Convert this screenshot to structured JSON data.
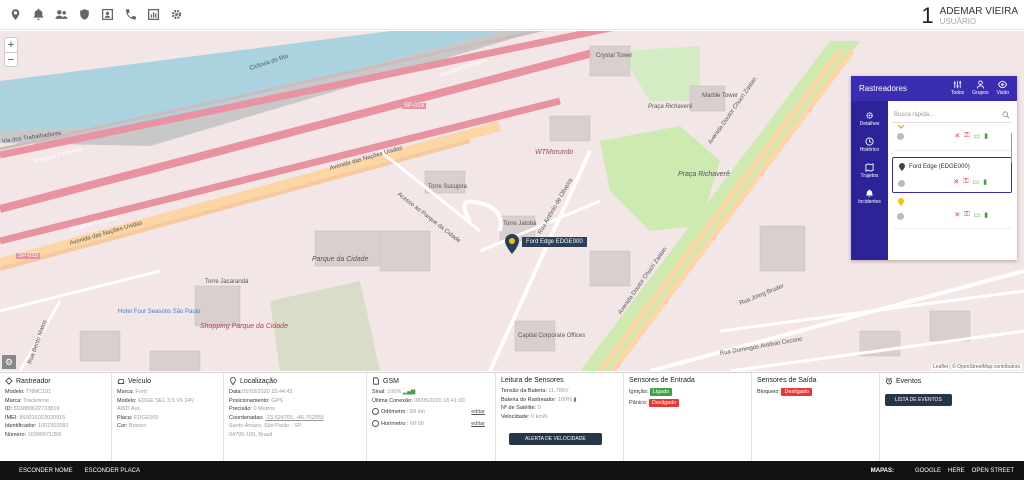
{
  "header": {
    "user_count": "1",
    "user_name": "ADEMAR VIEIRA",
    "user_role": "USUÁRIO"
  },
  "map": {
    "zoom_in": "+",
    "zoom_out": "−",
    "labels": {
      "marginal1": "Marginal Pinheiros",
      "marginal2": "Marginal Pinheiros",
      "marginal3": "Marginal Pinheiros",
      "nacoes1": "Avenida das Nações Unidas",
      "nacoes2": "Avenida das Nações Unidas",
      "sp015a": "SP-015",
      "sp015b": "SP-015",
      "ciclovia": "Ciclovia do Rio",
      "trabalhadores": "Via dos Trabalhadores",
      "crystal": "Crystal Tower",
      "marble": "Marble Tower",
      "wtmorumbi": "WTMorumbi",
      "pracaricha1": "Praça Richaverê",
      "pracaricha2": "Praça Richaverê",
      "sucupira": "Torre Sucupira",
      "jatoba": "Torre Jatobá",
      "capital": "Capital Corporate Offices",
      "parque": "Parque da Cidade",
      "shopping": "Shopping Parque da Cidade",
      "chucri1": "Avenida Doutor Chucri Zaidan",
      "chucri2": "Avenida Doutor Chucri Zaidan",
      "oliveira": "Rua Antônio de Oliveira",
      "acesso": "Acesso ao Parque da Cidade",
      "bruder": "Rua Joerg Bruder",
      "antonio_carlos": "Rua Domingos Antônio Cecone",
      "mattos": "Rua Bento Matos",
      "four_seasons": "Hotel Four Seasons São Paulo",
      "torre_jacaranda": "Torre Jacarandá"
    },
    "marker_label": "Ford Edge EDGE000",
    "attribution": "Leaflet | © OpenStreetMap contributors"
  },
  "trackers_panel": {
    "title": "Rastreadores",
    "views": [
      "Todos",
      "Grupos",
      "Visão"
    ],
    "side": [
      "Detalhes",
      "Histórico",
      "Trajetos",
      "Incidentes"
    ],
    "search_placeholder": "Busca rápida...",
    "items": [
      {
        "name": "",
        "pin_color": "#f39c12",
        "dot_color": "#bbb"
      },
      {
        "name": "Ford Edge (EDGE000)",
        "pin_color": "#444",
        "dot_color": "#bbb"
      },
      {
        "name": "",
        "pin_color": "#f1c40f",
        "dot_color": "#bbb"
      }
    ]
  },
  "info": {
    "rastreador": {
      "title": "Rastreador",
      "rows": [
        {
          "k": "Modelo:",
          "v": "TNMC101"
        },
        {
          "k": "Marca:",
          "v": "Trackmme"
        },
        {
          "k": "ID:",
          "v": "553889622733819"
        },
        {
          "k": "IMEI:",
          "v": "860016023020915"
        },
        {
          "k": "Identificador:",
          "v": "1602302091"
        },
        {
          "k": "Número:",
          "v": "16999971356"
        }
      ]
    },
    "veiculo": {
      "title": "Veículo",
      "rows": [
        {
          "k": "Marca:",
          "v": "Ford"
        },
        {
          "k": "Modelo:",
          "v": "EDGE SEL 3.5 V6 24V"
        },
        {
          "k": "",
          "v": "AWD Aut."
        },
        {
          "k": "Placa:",
          "v": "EDGE000"
        },
        {
          "k": "Cor:",
          "v": "Branco"
        }
      ]
    },
    "localizacao": {
      "title": "Localização",
      "rows": [
        {
          "k": "Data:",
          "v": "05/03/2020 15:44:43"
        },
        {
          "k": "Posicionamento:",
          "v": "GPS"
        },
        {
          "k": "Precisão:",
          "v": "0 Metros"
        },
        {
          "k": "Coordenadas:",
          "v": "-23.624765, -46.702555"
        },
        {
          "k": "",
          "v": "Santo Amaro, São Paulo - SP,"
        },
        {
          "k": "",
          "v": "04795-100, Brasil"
        }
      ]
    },
    "gsm": {
      "title": "GSM",
      "sinal_k": "Sinal:",
      "sinal_v": "100%",
      "ultima_k": "Última Conexão:",
      "ultima_v": "08/05/2020 16:41:00",
      "odometro_k": "Odômetro :",
      "odometro_v": "89 km",
      "horimetro_k": "Horímetro :",
      "horimetro_v": "00:00",
      "editar": "editar"
    },
    "sensores": {
      "title": "Leitura de Sensores",
      "rows": [
        {
          "k": "Tensão da Bateria:",
          "v": "11.786V"
        },
        {
          "k": "Bateria do Rastreador:",
          "v": "100%"
        },
        {
          "k": "Nº de Satélite:",
          "v": "0"
        },
        {
          "k": "Velocidade:",
          "v": "0 km/h"
        }
      ],
      "alerta_btn": "ALERTA DE VELOCIDADE"
    },
    "entrada": {
      "title": "Sensores de Entrada",
      "ignicao_k": "Ignição:",
      "ignicao_v": "Ligado",
      "panico_k": "Pânico:",
      "panico_v": "Desligado"
    },
    "saida": {
      "title": "Sensores de Saída",
      "bloqueio_k": "Bloqueio:",
      "bloqueio_v": "Desligado"
    },
    "eventos": {
      "title": "Eventos",
      "lista_btn": "LISTA DE EVENTOS"
    }
  },
  "footer": {
    "esconder_nome": "ESCONDER NOME",
    "esconder_placa": "ESCONDER PLACA",
    "mapas_label": "MAPAS:",
    "maps": [
      "GOOGLE",
      "HERE",
      "OPEN STREET"
    ]
  },
  "colors": {
    "panel_header": "#3a2db1",
    "panel_side": "#2d2398",
    "on": "#43a047",
    "off": "#e53935",
    "dark_button": "#263547"
  }
}
